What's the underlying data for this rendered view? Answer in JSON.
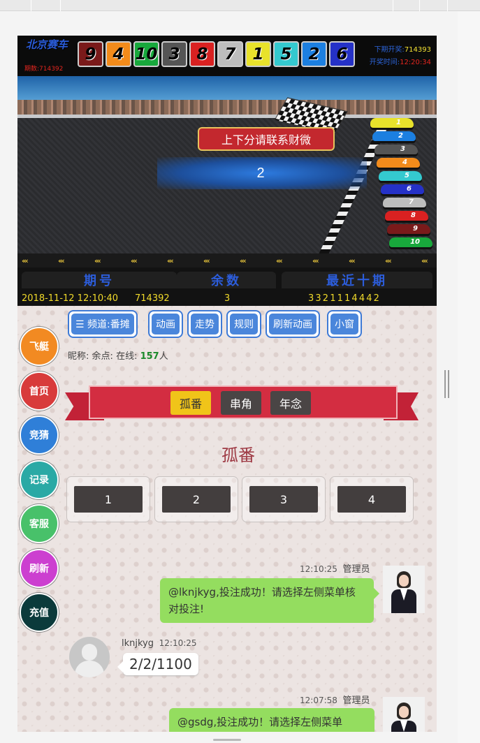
{
  "header": {
    "brand": "北京赛车",
    "current_period": "期数:714392",
    "draw_numbers": [
      "9",
      "4",
      "10",
      "3",
      "8",
      "7",
      "1",
      "5",
      "2",
      "6"
    ],
    "ball_colors": [
      "#e8e22b",
      "#1c7fe0",
      "#555555",
      "#f28b1b",
      "#34c9cf",
      "#2531c7",
      "#bdbdbd",
      "#d92121",
      "#7a1a1a",
      "#18a83c"
    ],
    "next_period_label": "下期开奖:",
    "next_period_value": "714393",
    "draw_time_label": "开奖时间:",
    "draw_time_value": "12:20:34"
  },
  "scene": {
    "banner": "上下分请联系财微",
    "countdown": "2"
  },
  "results": {
    "period_header": "期号",
    "remainder_header": "余数",
    "recent_header": "最近十期",
    "period_time": "2018-11-12 12:10:40",
    "period_number": "714392",
    "remainder_value": "3",
    "recent_value": "3 3 2 1 1 1 4 4 4 2"
  },
  "side_menu": [
    {
      "label": "飞艇",
      "color": "#f28a22"
    },
    {
      "label": "首页",
      "color": "#d83b3b"
    },
    {
      "label": "竞猜",
      "color": "#2f7fd8"
    },
    {
      "label": "记录",
      "color": "#2aa9a5"
    },
    {
      "label": "客服",
      "color": "#48c16a"
    },
    {
      "label": "刷新",
      "color": "#cc3fd0"
    },
    {
      "label": "充值",
      "color": "#0b3a3b"
    }
  ],
  "nav": {
    "channel": "☰ 频道:番摊",
    "animation": "动画",
    "trend": "走势",
    "rules": "规则",
    "refresh_animation": "刷新动画",
    "small_window": "小窗"
  },
  "user": {
    "nickname_label": "昵称:",
    "balance_label": "余点:",
    "online_label": "在线:",
    "online_count": "157",
    "online_unit": "人"
  },
  "bet_tabs": [
    {
      "label": "孤番",
      "active": true
    },
    {
      "label": "串角",
      "active": false
    },
    {
      "label": "年念",
      "active": false
    }
  ],
  "section_title": "孤番",
  "options": [
    "1",
    "2",
    "3",
    "4"
  ],
  "chat": [
    {
      "time": "12:10:25",
      "name": "管理员",
      "text": "@lknjkyg,投注成功！请选择左侧菜单核对投注!"
    },
    {
      "time": "12:10:25",
      "name": "lknjkyg",
      "text": "2/2/1100"
    },
    {
      "time": "12:07:58",
      "name": "管理员",
      "text": "@gsdg,投注成功！请选择左侧菜单"
    }
  ]
}
